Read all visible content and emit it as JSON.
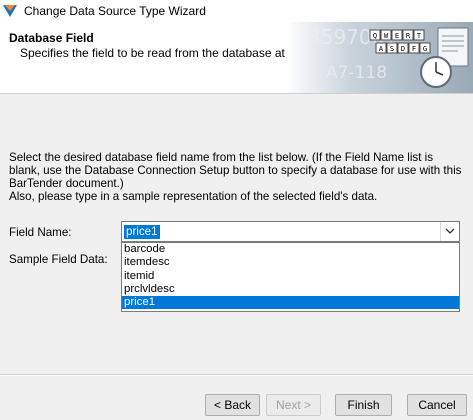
{
  "window": {
    "title": "Change Data Source Type Wizard"
  },
  "header": {
    "title": "Database Field",
    "subtitle": "Specifies the field to be read from the database at print-time.",
    "banner": {
      "digits": "3597001",
      "code": "A7-118",
      "keys_row1": [
        "Q",
        "W",
        "E",
        "R",
        "T"
      ],
      "keys_row2": [
        "A",
        "S",
        "D",
        "F",
        "G"
      ]
    }
  },
  "instructions": {
    "line1": "Select the desired database field name from the list below.  (If the Field Name list is blank, use the Database Connection Setup button to specify a database for use with this BarTender document.)",
    "line2": "Also, please type in a sample representation of the selected field's data."
  },
  "form": {
    "field_name_label": "Field Name:",
    "field_name_value": "price1",
    "sample_label": "Sample Field Data:",
    "options": [
      "barcode",
      "itemdesc",
      "itemid",
      "prclvldesc",
      "price1"
    ],
    "selected_option": "price1"
  },
  "buttons": {
    "back": "< Back",
    "next": "Next >",
    "finish": "Finish",
    "cancel": "Cancel"
  },
  "colors": {
    "selection": "#0078d7",
    "dialog_bg": "#f0f0f0"
  }
}
